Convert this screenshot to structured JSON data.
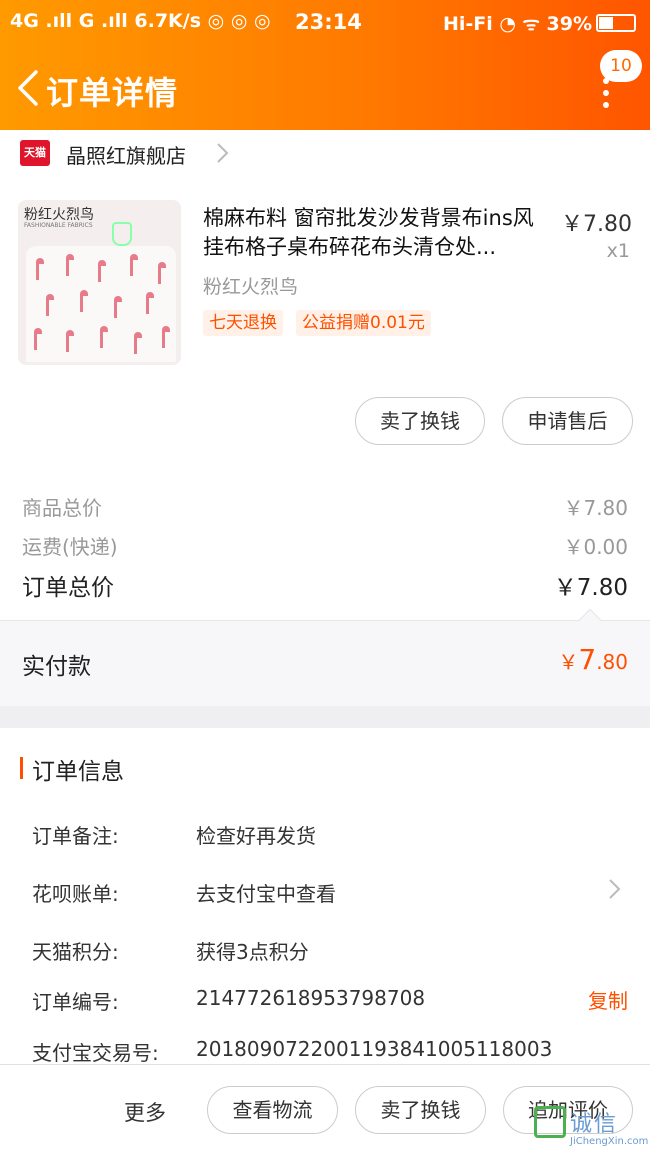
{
  "status_bar": {
    "left": "4G .ıll G .ıll 6.7K/s ◎ ◎ ◎",
    "time": "23:14",
    "right": "Hi-Fi ◔ ᯤ 39%"
  },
  "nav": {
    "title": "订单详情",
    "message_count": "10"
  },
  "shop": {
    "logo_text": "天猫",
    "name": "晶照红旗舰店"
  },
  "product": {
    "image_text": "粉红火烈鸟",
    "image_subtext": "FASHIONABLE FABRICS",
    "title": "棉麻布料 窗帘批发沙发背景布ins风挂布格子桌布碎花布头清仓处...",
    "price": "￥7.80",
    "quantity": "x1",
    "sku": "粉红火烈鸟",
    "tags": [
      "七天退换",
      "公益捐赠0.01元"
    ]
  },
  "item_actions": {
    "sell": "卖了换钱",
    "after_sale": "申请售后"
  },
  "summary": {
    "goods_label": "商品总价",
    "goods_value": "￥7.80",
    "shipping_label": "运费(快递)",
    "shipping_value": "￥0.00",
    "total_label": "订单总价",
    "total_value": "￥7.80"
  },
  "paid": {
    "label": "实付款",
    "currency": "￥",
    "integer": "7",
    "decimal": ".80"
  },
  "order_info": {
    "title": "订单信息",
    "rows": [
      {
        "label": "订单备注:",
        "value": "检查好再发货"
      },
      {
        "label": "花呗账单:",
        "value": "去支付宝中查看"
      },
      {
        "label": "天猫积分:",
        "value": "获得3点积分"
      },
      {
        "label": "订单编号:",
        "value": "214772618953798708"
      },
      {
        "label": "支付宝交易号:",
        "value": "2018090722001193841005118003"
      }
    ],
    "copy": "复制"
  },
  "bottom_bar": {
    "more": "更多",
    "logistics": "查看物流",
    "sell": "卖了换钱",
    "review": "追加评价"
  },
  "watermark": {
    "text": "诚信",
    "url": "JiChengXin.com"
  },
  "colors": {
    "header_start": "#ff9a00",
    "header_end": "#ff5500",
    "accent": "#ff5000"
  }
}
